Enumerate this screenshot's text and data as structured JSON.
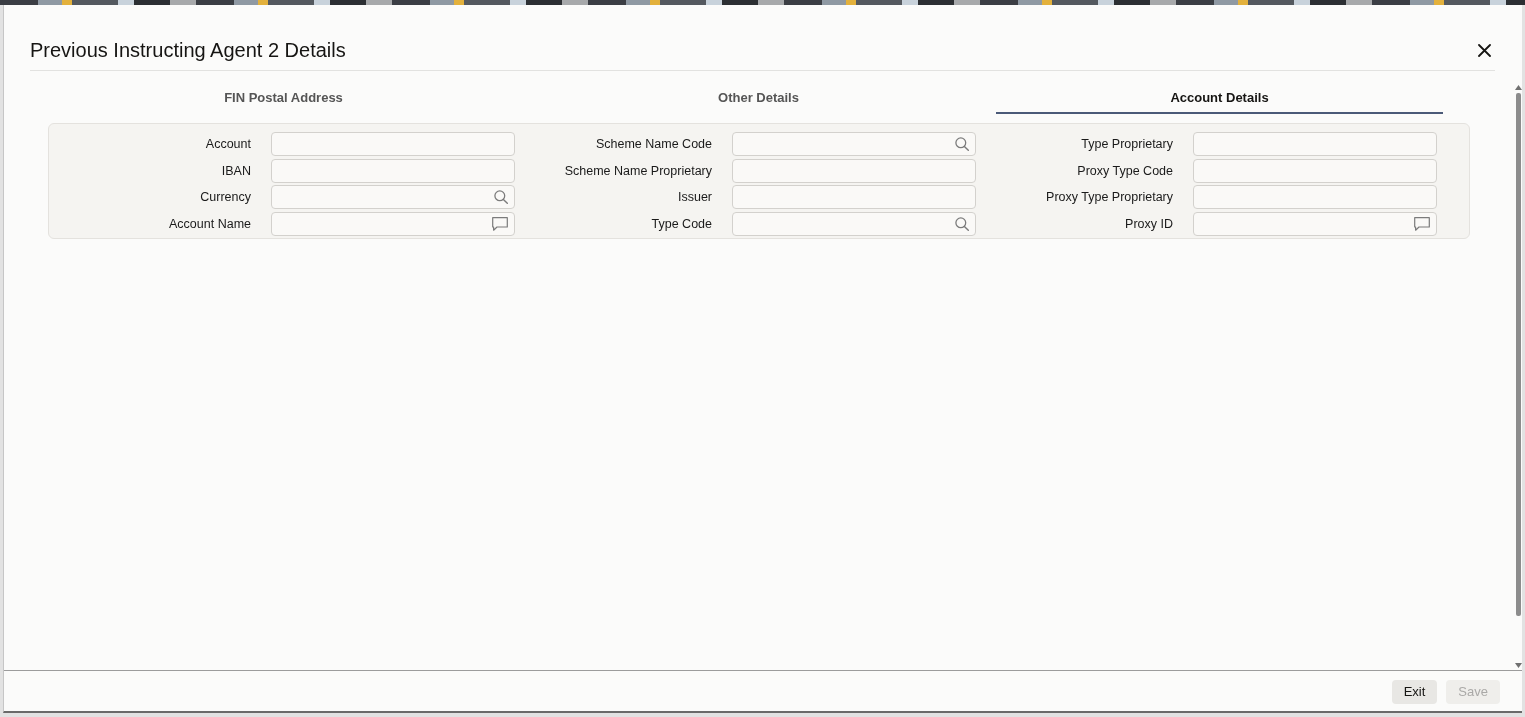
{
  "dialog": {
    "title": "Previous Instructing Agent 2 Details"
  },
  "tabs": [
    {
      "label": "FIN Postal Address",
      "selected": false
    },
    {
      "label": "Other Details",
      "selected": false
    },
    {
      "label": "Account Details",
      "selected": true
    }
  ],
  "form": {
    "columns": [
      {
        "fields": [
          {
            "label": "Account",
            "kind": "text"
          },
          {
            "label": "IBAN",
            "kind": "text"
          },
          {
            "label": "Currency",
            "kind": "lookup"
          },
          {
            "label": "Account Name",
            "kind": "note"
          }
        ]
      },
      {
        "fields": [
          {
            "label": "Scheme Name Code",
            "kind": "lookup"
          },
          {
            "label": "Scheme Name Proprietary",
            "kind": "text"
          },
          {
            "label": "Issuer",
            "kind": "text"
          },
          {
            "label": "Type Code",
            "kind": "lookup"
          }
        ]
      },
      {
        "fields": [
          {
            "label": "Type Proprietary",
            "kind": "text"
          },
          {
            "label": "Proxy Type Code",
            "kind": "text"
          },
          {
            "label": "Proxy Type Proprietary",
            "kind": "text"
          },
          {
            "label": "Proxy ID",
            "kind": "note"
          }
        ]
      }
    ]
  },
  "buttons": [
    {
      "label": "Exit",
      "disabled": false
    },
    {
      "label": "Save",
      "disabled": true
    }
  ]
}
